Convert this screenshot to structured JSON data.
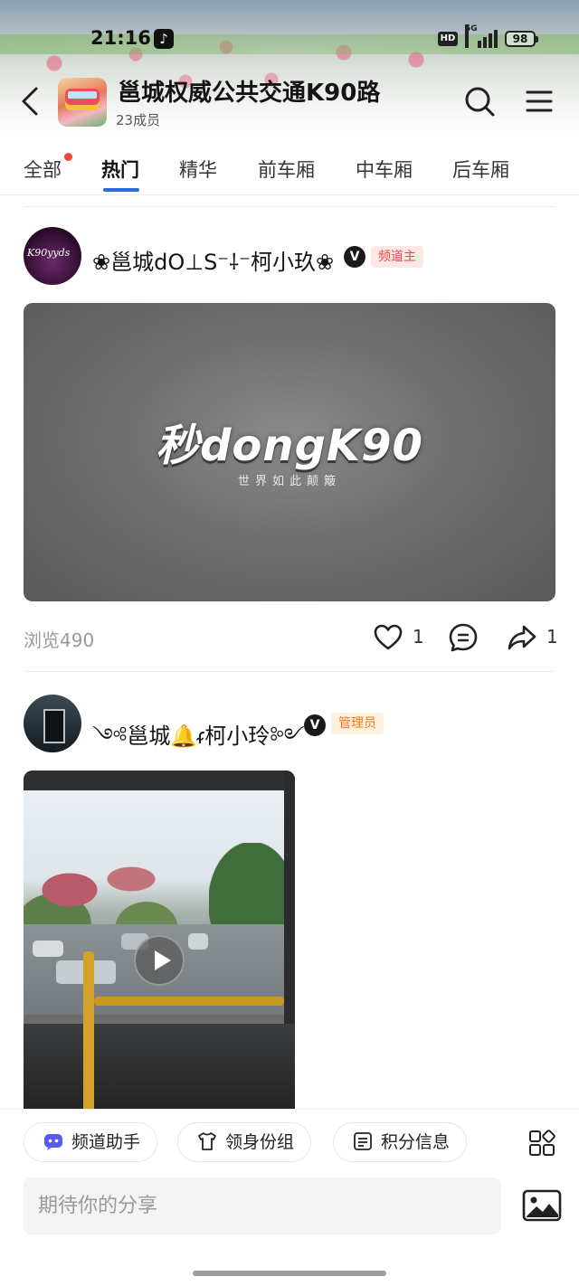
{
  "status_bar": {
    "time": "21:16",
    "network": "5G",
    "hd": "HD",
    "battery": "98"
  },
  "header": {
    "channel_title": "邕城权威公共交通K90路",
    "member_count": "23成员"
  },
  "tabs": [
    {
      "label": "全部",
      "has_dot": true
    },
    {
      "label": "热门",
      "active": true
    },
    {
      "label": "精华"
    },
    {
      "label": "前车厢"
    },
    {
      "label": "中车厢"
    },
    {
      "label": "后车厢"
    }
  ],
  "posts": [
    {
      "avatar_text": "K90yyds",
      "author": "❀邕城dO⊥S⁻⸸⁻柯小玖❀",
      "verified": "V",
      "role": "频道主",
      "video": {
        "logo": "秒dongK90",
        "slogan": "世界如此颠簸"
      },
      "views": "浏览490",
      "likes": "1",
      "shares": "1"
    },
    {
      "author": "༺邕城🔔ᵳ柯小玲༻",
      "verified": "V",
      "role": "管理员"
    }
  ],
  "bottom": {
    "chips": [
      {
        "label": "频道助手",
        "icon": "assistant-icon"
      },
      {
        "label": "领身份组",
        "icon": "shirt-icon"
      },
      {
        "label": "积分信息",
        "icon": "points-icon"
      }
    ],
    "input_placeholder": "期待你的分享"
  },
  "colors": {
    "accent_blue": "#2d6bd6",
    "notice_red": "#f0443a",
    "owner_badge": "#e04848",
    "admin_badge": "#f07b1e"
  }
}
